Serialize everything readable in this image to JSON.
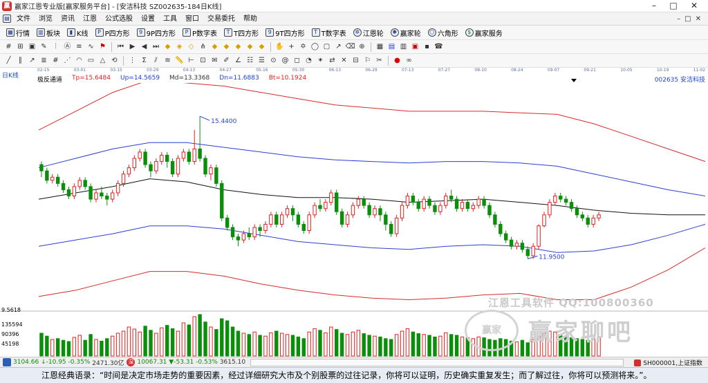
{
  "window": {
    "title": "赢家江恩专业版[赢家服务平台] - [安洁科技  SZ002635-184日K线]"
  },
  "menu": [
    "文件",
    "浏览",
    "资讯",
    "江恩",
    "公式选股",
    "设置",
    "工具",
    "窗口",
    "交易委托",
    "帮助"
  ],
  "toolbar_main": [
    {
      "label": "行情",
      "icon": "grid-icon"
    },
    {
      "label": "板块",
      "icon": "blocks-icon"
    },
    {
      "label": "K线",
      "icon": "candle-icon"
    },
    {
      "label": "P四方形",
      "icon": "square-p-icon"
    },
    {
      "label": "9P四方形",
      "icon": "square-9p-icon"
    },
    {
      "label": "P数字表",
      "icon": "table-p-icon"
    },
    {
      "label": "T四方形",
      "icon": "square-t-icon"
    },
    {
      "label": "9T四方形",
      "icon": "square-9t-icon"
    },
    {
      "label": "T数字表",
      "icon": "table-t-icon"
    },
    {
      "label": "江恩轮",
      "icon": "wheel-icon"
    },
    {
      "label": "赢家轮",
      "icon": "winner-wheel-icon"
    },
    {
      "label": "六角形",
      "icon": "hexagon-icon"
    },
    {
      "label": "赢家服务",
      "icon": "dollar-icon"
    }
  ],
  "chart_header": {
    "period": "日K线",
    "indicator": "极反通道",
    "tp": "Tp=15.6484",
    "up": "Up=14.5659",
    "md": "Md=13.3368",
    "dn": "Dn=11.6883",
    "bt": "Bt=10.1924",
    "stock": "002635  安洁科技"
  },
  "date_ticks": [
    "02-15",
    "03-01",
    "03-15",
    "03-29",
    "04-13",
    "04-27",
    "05-16",
    "05-30",
    "06-13",
    "06-29",
    "07-13",
    "07-27",
    "08-10",
    "08-24",
    "09-07",
    "09-21",
    "10-05",
    "10-19",
    "11-02"
  ],
  "annotations": {
    "high": "15.4400",
    "low": "11.9500"
  },
  "volume_axis": {
    "max": "9.5618",
    "labels": [
      "135594",
      "90396",
      "45198"
    ]
  },
  "watermark": {
    "line1": "江恩工具软件  QQ:100800360",
    "line2": "赢家聊吧",
    "seal": "赢家"
  },
  "statusbar": {
    "sh_index": "3104.66",
    "sh_change": "↓-10.95",
    "sh_pct": "-0.35%",
    "sh_amount": "2471.30亿",
    "sz_index": "10067.31",
    "sz_change": "▼-53.31",
    "sz_pct": "-0.53%",
    "sz_amount": "3615.10",
    "right_label": "SH000001,上证指数"
  },
  "quote": "江恩经典语录：“时间是决定市场走势的重要因素，经过详细研究大市及个别股票的过往记录，你将可以证明，历史确实重复发生；而了解过往，你将可以预测将来。”。",
  "chart_data": {
    "type": "candlestick",
    "y_range": [
      9.5,
      16.5
    ],
    "high_marker": 15.44,
    "low_marker": 11.95,
    "channels": {
      "top": [
        15.0,
        15.6,
        16.2,
        16.6,
        16.5,
        16.4,
        16.2,
        16.0,
        15.8,
        15.7,
        15.6,
        15.6,
        15.6,
        15.55,
        15.5,
        15.2,
        14.8,
        14.4,
        14.0
      ],
      "upper": [
        13.8,
        14.1,
        14.4,
        14.6,
        14.6,
        14.45,
        14.3,
        14.15,
        14.05,
        14.0,
        13.95,
        14.0,
        14.0,
        13.95,
        13.85,
        13.6,
        13.35,
        13.1,
        12.9
      ],
      "mid": [
        12.8,
        13.0,
        13.2,
        13.45,
        13.35,
        13.1,
        12.95,
        12.85,
        12.85,
        12.8,
        12.7,
        12.75,
        12.8,
        12.7,
        12.6,
        12.45,
        12.35,
        12.3,
        12.3
      ],
      "lower": [
        11.3,
        11.5,
        11.7,
        11.95,
        11.95,
        11.85,
        11.65,
        11.45,
        11.35,
        11.25,
        11.2,
        11.3,
        11.35,
        11.3,
        11.1,
        11.15,
        11.35,
        11.65,
        12.0
      ],
      "bottom": [
        9.7,
        9.9,
        10.2,
        10.5,
        10.5,
        10.35,
        10.1,
        9.9,
        9.75,
        9.65,
        9.6,
        9.65,
        9.75,
        9.8,
        9.6,
        9.6,
        10.0,
        10.55,
        11.25
      ]
    },
    "candles": [
      [
        13.9,
        13.7,
        14.0,
        13.5
      ],
      [
        13.7,
        13.4,
        13.8,
        13.3
      ],
      [
        13.4,
        13.5,
        13.6,
        13.3
      ],
      [
        13.5,
        13.3,
        13.6,
        13.2
      ],
      [
        13.3,
        13.1,
        13.4,
        13.0
      ],
      [
        13.1,
        12.9,
        13.2,
        12.8
      ],
      [
        12.9,
        13.2,
        13.3,
        12.8
      ],
      [
        13.2,
        13.4,
        13.5,
        13.1
      ],
      [
        13.4,
        13.2,
        13.5,
        13.1
      ],
      [
        13.2,
        12.8,
        13.3,
        12.7
      ],
      [
        12.8,
        13.0,
        13.1,
        12.7
      ],
      [
        13.0,
        12.9,
        13.2,
        12.8
      ],
      [
        12.9,
        12.8,
        13.0,
        12.6
      ],
      [
        12.8,
        13.0,
        13.1,
        12.7
      ],
      [
        13.0,
        13.3,
        13.4,
        12.9
      ],
      [
        13.3,
        13.6,
        13.7,
        13.2
      ],
      [
        13.6,
        13.8,
        13.9,
        13.5
      ],
      [
        13.8,
        14.1,
        14.2,
        13.7
      ],
      [
        14.1,
        14.3,
        14.4,
        14.0
      ],
      [
        14.3,
        13.9,
        14.4,
        13.8
      ],
      [
        13.9,
        13.7,
        14.0,
        13.5
      ],
      [
        13.7,
        14.0,
        14.1,
        13.6
      ],
      [
        14.0,
        14.2,
        14.3,
        13.9
      ],
      [
        14.2,
        14.0,
        14.3,
        13.8
      ],
      [
        14.0,
        13.6,
        14.1,
        13.5
      ],
      [
        13.6,
        14.1,
        14.2,
        13.5
      ],
      [
        14.1,
        14.3,
        14.4,
        14.0
      ],
      [
        14.3,
        14.0,
        14.4,
        13.9
      ],
      [
        14.0,
        14.4,
        15.0,
        13.9
      ],
      [
        14.4,
        14.1,
        15.44,
        14.0
      ],
      [
        14.1,
        13.6,
        14.2,
        13.5
      ],
      [
        13.6,
        13.8,
        13.9,
        13.4
      ],
      [
        13.8,
        13.3,
        13.9,
        13.2
      ],
      [
        13.3,
        12.2,
        13.4,
        12.1
      ],
      [
        12.2,
        11.9,
        12.3,
        11.8
      ],
      [
        11.9,
        11.6,
        12.0,
        11.5
      ],
      [
        11.6,
        11.5,
        11.7,
        11.3
      ],
      [
        11.5,
        11.7,
        11.8,
        11.4
      ],
      [
        11.7,
        11.6,
        11.9,
        11.5
      ],
      [
        11.6,
        11.9,
        12.0,
        11.5
      ],
      [
        11.9,
        11.8,
        12.0,
        11.6
      ],
      [
        11.8,
        12.0,
        12.1,
        11.7
      ],
      [
        12.0,
        12.3,
        12.4,
        11.9
      ],
      [
        12.3,
        12.0,
        12.4,
        11.9
      ],
      [
        12.0,
        12.3,
        12.4,
        11.9
      ],
      [
        12.3,
        12.5,
        12.6,
        12.2
      ],
      [
        12.5,
        12.3,
        12.6,
        12.1
      ],
      [
        12.3,
        12.0,
        12.4,
        11.9
      ],
      [
        12.0,
        11.8,
        12.1,
        11.7
      ],
      [
        11.8,
        12.3,
        12.4,
        11.7
      ],
      [
        12.3,
        12.6,
        12.7,
        12.2
      ],
      [
        12.6,
        12.5,
        12.8,
        12.4
      ],
      [
        12.5,
        12.7,
        12.8,
        12.4
      ],
      [
        12.7,
        13.0,
        13.1,
        12.6
      ],
      [
        13.0,
        12.4,
        13.1,
        12.3
      ],
      [
        12.4,
        12.0,
        12.5,
        11.9
      ],
      [
        12.0,
        12.3,
        12.4,
        11.9
      ],
      [
        12.3,
        12.6,
        12.7,
        12.2
      ],
      [
        12.6,
        12.8,
        12.9,
        12.5
      ],
      [
        12.8,
        12.6,
        12.9,
        12.5
      ],
      [
        12.6,
        12.3,
        12.7,
        12.2
      ],
      [
        12.3,
        12.5,
        12.6,
        12.2
      ],
      [
        12.5,
        12.3,
        12.6,
        12.1
      ],
      [
        12.3,
        12.0,
        12.4,
        11.8
      ],
      [
        12.0,
        11.7,
        12.1,
        11.6
      ],
      [
        11.7,
        12.2,
        12.3,
        11.6
      ],
      [
        12.2,
        12.6,
        12.7,
        12.1
      ],
      [
        12.6,
        12.9,
        13.0,
        12.5
      ],
      [
        12.9,
        12.7,
        13.0,
        12.6
      ],
      [
        12.7,
        12.5,
        12.8,
        12.4
      ],
      [
        12.5,
        12.8,
        12.9,
        12.4
      ],
      [
        12.8,
        12.6,
        12.9,
        12.5
      ],
      [
        12.6,
        12.4,
        12.7,
        12.3
      ],
      [
        12.4,
        12.6,
        12.7,
        12.3
      ],
      [
        12.6,
        12.9,
        13.0,
        12.5
      ],
      [
        12.9,
        12.8,
        13.1,
        12.7
      ],
      [
        12.8,
        12.5,
        12.9,
        12.4
      ],
      [
        12.5,
        12.7,
        12.8,
        12.4
      ],
      [
        12.7,
        12.5,
        12.8,
        12.4
      ],
      [
        12.5,
        12.6,
        12.7,
        12.4
      ],
      [
        12.6,
        12.8,
        12.9,
        12.5
      ],
      [
        12.8,
        12.6,
        12.9,
        12.5
      ],
      [
        12.6,
        12.3,
        12.7,
        12.2
      ],
      [
        12.3,
        12.0,
        12.4,
        11.9
      ],
      [
        12.0,
        11.7,
        12.1,
        11.6
      ],
      [
        11.7,
        11.5,
        11.8,
        11.4
      ],
      [
        11.5,
        11.3,
        11.6,
        11.2
      ],
      [
        11.3,
        11.4,
        11.5,
        11.2
      ],
      [
        11.4,
        11.2,
        11.5,
        11.1
      ],
      [
        11.2,
        11.0,
        11.3,
        10.9
      ],
      [
        11.0,
        11.3,
        11.4,
        10.9
      ],
      [
        11.3,
        11.95,
        12.0,
        11.2
      ],
      [
        11.95,
        12.3,
        12.4,
        11.9
      ],
      [
        12.3,
        12.7,
        12.8,
        12.2
      ],
      [
        12.7,
        12.9,
        13.0,
        12.6
      ],
      [
        12.9,
        12.8,
        13.0,
        12.7
      ],
      [
        12.8,
        12.7,
        12.9,
        12.6
      ],
      [
        12.7,
        12.5,
        12.8,
        12.4
      ],
      [
        12.5,
        12.3,
        12.6,
        12.2
      ],
      [
        12.3,
        12.2,
        12.4,
        12.1
      ],
      [
        12.2,
        12.0,
        12.3,
        11.9
      ],
      [
        12.0,
        12.2,
        12.3,
        11.9
      ],
      [
        12.2,
        12.3,
        12.4,
        12.1
      ]
    ],
    "volumes": [
      55,
      48,
      40,
      42,
      38,
      35,
      45,
      50,
      38,
      52,
      40,
      36,
      42,
      48,
      55,
      60,
      70,
      65,
      58,
      72,
      62,
      55,
      68,
      74,
      66,
      60,
      80,
      75,
      95,
      100,
      82,
      70,
      64,
      90,
      85,
      70,
      60,
      55,
      52,
      58,
      50,
      48,
      56,
      60,
      55,
      52,
      50,
      46,
      42,
      58,
      66,
      62,
      56,
      70,
      64,
      55,
      52,
      58,
      62,
      54,
      50,
      48,
      46,
      42,
      40,
      52,
      60,
      66,
      58,
      54,
      52,
      50,
      46,
      48,
      56,
      52,
      50,
      46,
      44,
      42,
      46,
      44,
      40,
      38,
      42,
      40,
      36,
      34,
      38,
      32,
      40,
      48,
      55,
      60,
      58,
      52,
      48,
      44,
      42,
      40,
      38,
      42,
      44
    ]
  }
}
